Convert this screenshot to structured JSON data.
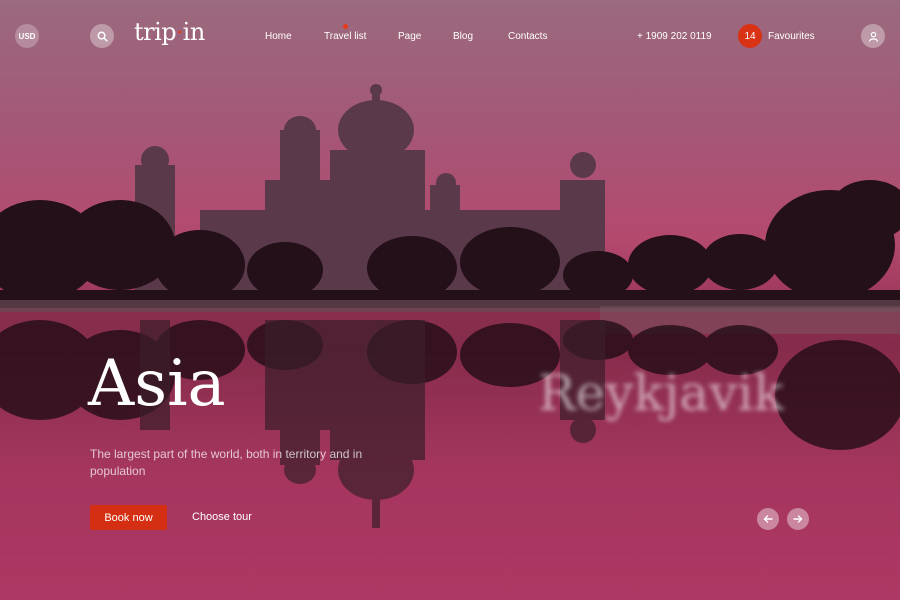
{
  "header": {
    "currency": "USD",
    "logo": {
      "part1": "trip",
      "dot": "·",
      "part2": "in"
    },
    "nav": [
      "Home",
      "Travel list",
      "Page",
      "Blog",
      "Contacts"
    ],
    "active_nav": "Travel list",
    "phone": "+ 1909 202 0119",
    "favourites": {
      "count": "14",
      "label": "Favourites"
    }
  },
  "hero": {
    "title": "Asia",
    "next_title": "Reykjavik",
    "subtitle": "The largest part of the world, both in territory and in population",
    "primary_cta": "Book now",
    "secondary_cta": "Choose tour"
  },
  "icons": {
    "search": "search-icon",
    "user": "user-icon",
    "prev": "arrow-left-icon",
    "next": "arrow-right-icon"
  },
  "colors": {
    "accent": "#d42f12",
    "background_top": "#9a6a7e",
    "background_mid": "#b4496e"
  }
}
